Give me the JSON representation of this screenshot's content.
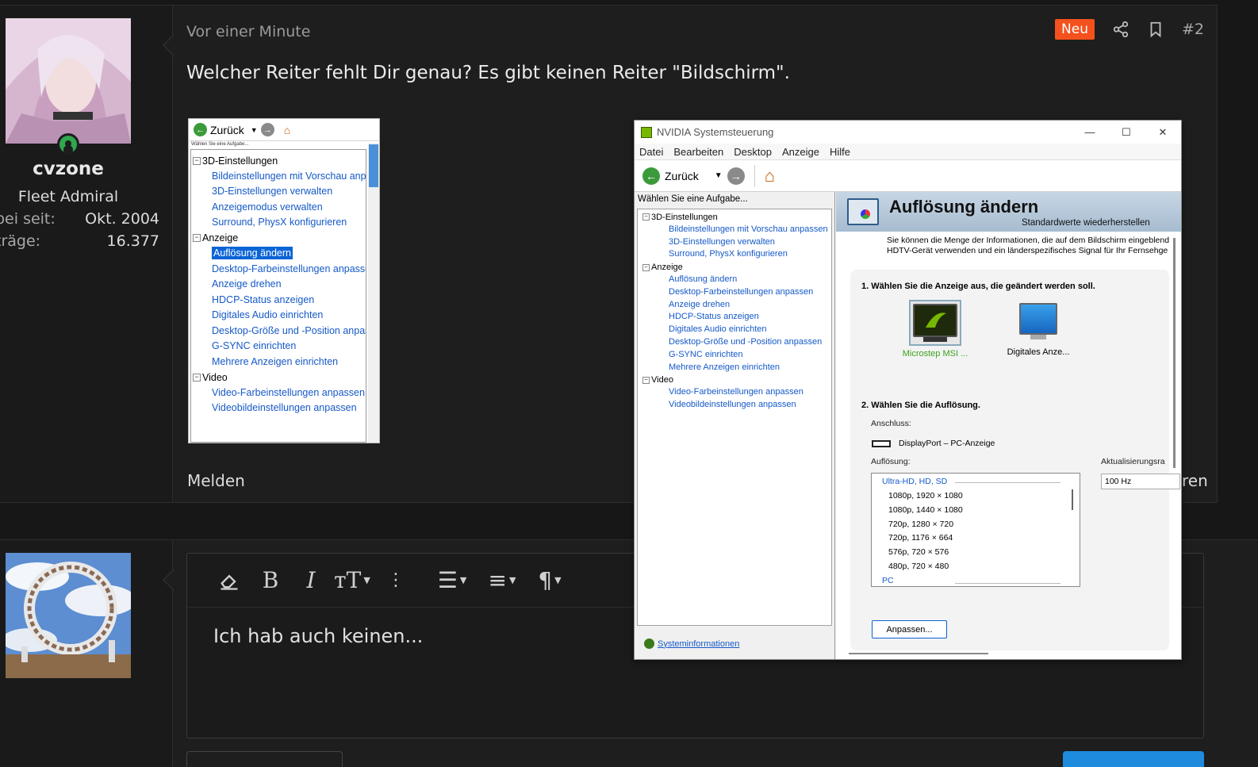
{
  "post": {
    "time": "Vor einer Minute",
    "badge": "Neu",
    "number": "#2",
    "text": "Welcher Reiter fehlt Dir genau? Es gibt keinen Reiter \"Bildschirm\".",
    "report": "Melden",
    "trailing": "ren",
    "accent_color": "#f4511e"
  },
  "user": {
    "name": "cvzone",
    "title": "Fleet Admiral",
    "stats": [
      {
        "label": "bei seit:",
        "value": "Okt. 2004"
      },
      {
        "label": "träge:",
        "value": "16.377"
      }
    ],
    "status": "online"
  },
  "small_screenshot": {
    "back_label": "Zurück",
    "hint": "Wählen Sie eine Aufgabe...",
    "tree": [
      {
        "cat": "3D-Einstellungen",
        "items": [
          "Bildeinstellungen mit Vorschau anpa",
          "3D-Einstellungen verwalten",
          "Anzeigemodus verwalten",
          "Surround, PhysX konfigurieren"
        ]
      },
      {
        "cat": "Anzeige",
        "items": [
          "Auflösung ändern",
          "Desktop-Farbeinstellungen anpassen",
          "Anzeige drehen",
          "HDCP-Status anzeigen",
          "Digitales Audio einrichten",
          "Desktop-Größe und -Position anpass",
          "G-SYNC einrichten",
          "Mehrere Anzeigen einrichten"
        ]
      },
      {
        "cat": "Video",
        "items": [
          "Video-Farbeinstellungen anpassen",
          "Videobildeinstellungen anpassen"
        ]
      }
    ],
    "selected": "Auflösung ändern"
  },
  "nvidia": {
    "window_title": "NVIDIA Systemsteuerung",
    "menu": [
      "Datei",
      "Bearbeiten",
      "Desktop",
      "Anzeige",
      "Hilfe"
    ],
    "back_label": "Zurück",
    "hint": "Wählen Sie eine Aufgabe...",
    "tree": [
      {
        "cat": "3D-Einstellungen",
        "items": [
          "Bildeinstellungen mit Vorschau anpassen",
          "3D-Einstellungen verwalten",
          "Surround, PhysX konfigurieren"
        ]
      },
      {
        "cat": "Anzeige",
        "items": [
          "Auflösung ändern",
          "Desktop-Farbeinstellungen anpassen",
          "Anzeige drehen",
          "HDCP-Status anzeigen",
          "Digitales Audio einrichten",
          "Desktop-Größe und -Position anpassen",
          "G-SYNC einrichten",
          "Mehrere Anzeigen einrichten"
        ]
      },
      {
        "cat": "Video",
        "items": [
          "Video-Farbeinstellungen anpassen",
          "Videobildeinstellungen anpassen"
        ]
      }
    ],
    "sysinfo": "Systeminformationen",
    "heading": "Auflösung ändern",
    "reset": "Standardwerte wiederherstellen",
    "desc_line1": "Sie können die Menge der Informationen, die auf dem Bildschirm eingeblend",
    "desc_line2": "HDTV-Gerät verwenden und ein länderspezifisches Signal für Ihr Fernsehge",
    "step1": "1. Wählen Sie die Anzeige aus, die geändert werden soll.",
    "monitor1": "Microstep MSI ...",
    "monitor2": "Digitales Anze...",
    "step2": "2. Wählen Sie die Auflösung.",
    "connection_label": "Anschluss:",
    "connection_value": "DisplayPort – PC-Anzeige",
    "resolution_label": "Auflösung:",
    "refresh_label": "Aktualisierungsra",
    "refresh_value": "100 Hz",
    "group": "Ultra-HD, HD, SD",
    "resolutions": [
      "1080p, 1920 × 1080",
      "1080p, 1440 × 1080",
      "720p, 1280 × 720",
      "720p, 1176 × 664",
      "576p, 720 × 576",
      "480p, 720 × 480"
    ],
    "group2": "PC",
    "customize": "Anpassen...",
    "brand_color": "#76b900"
  },
  "reply": {
    "text": "Ich hab auch keinen..."
  }
}
